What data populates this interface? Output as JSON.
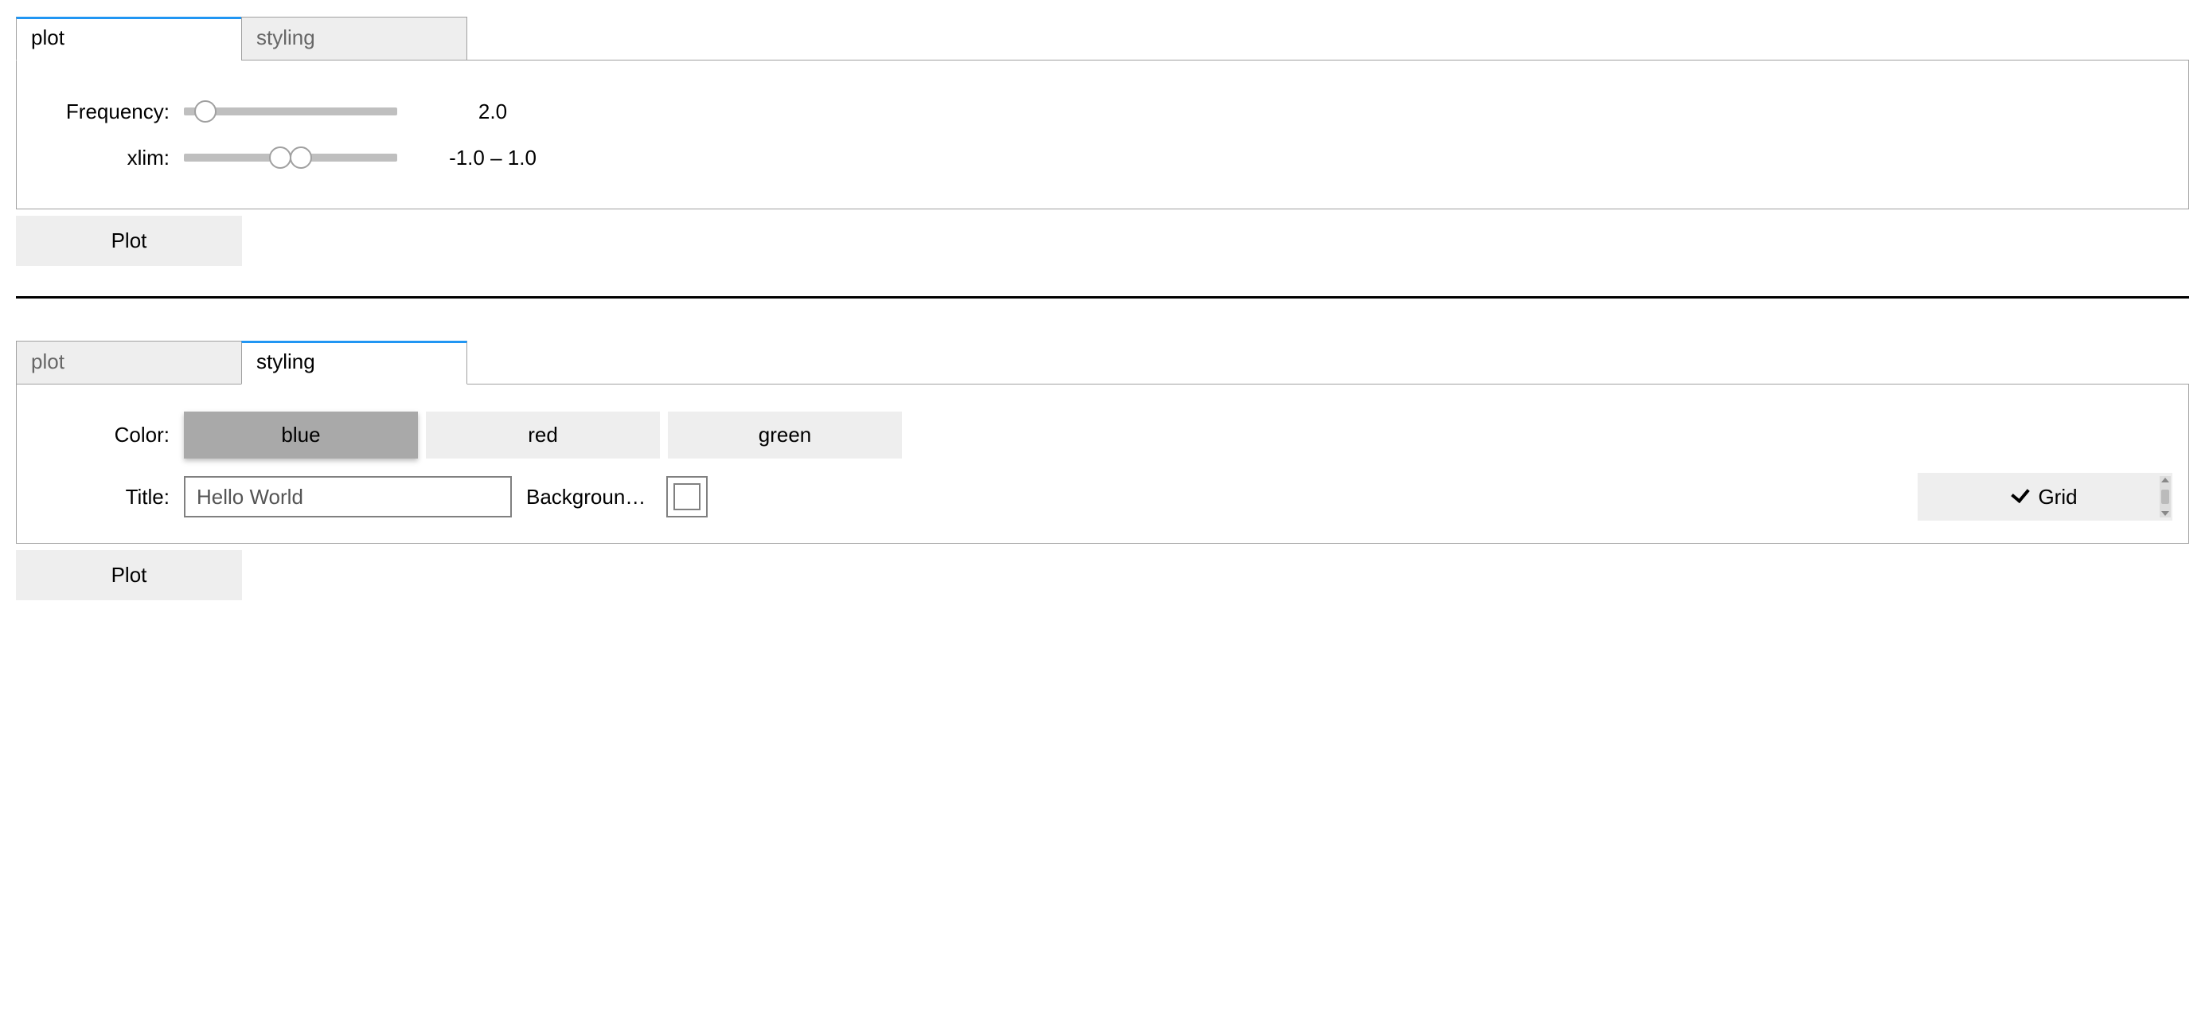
{
  "panel1": {
    "tabs": [
      {
        "label": "plot",
        "active": true
      },
      {
        "label": "styling",
        "active": false
      }
    ],
    "controls": {
      "frequency": {
        "label": "Frequency:",
        "value_display": "2.0",
        "thumb_pct": 10
      },
      "xlim": {
        "label": "xlim:",
        "value_display": "-1.0 – 1.0",
        "thumb_low_pct": 45,
        "thumb_high_pct": 55
      }
    },
    "plot_button": "Plot"
  },
  "panel2": {
    "tabs": [
      {
        "label": "plot",
        "active": false
      },
      {
        "label": "styling",
        "active": true
      }
    ],
    "controls": {
      "color": {
        "label": "Color:",
        "options": [
          "blue",
          "red",
          "green"
        ],
        "selected": "blue"
      },
      "title": {
        "label": "Title:",
        "value": "Hello World"
      },
      "background": {
        "label": "Backgroun…"
      },
      "grid": {
        "label": "Grid",
        "checked": true
      }
    },
    "plot_button": "Plot"
  }
}
